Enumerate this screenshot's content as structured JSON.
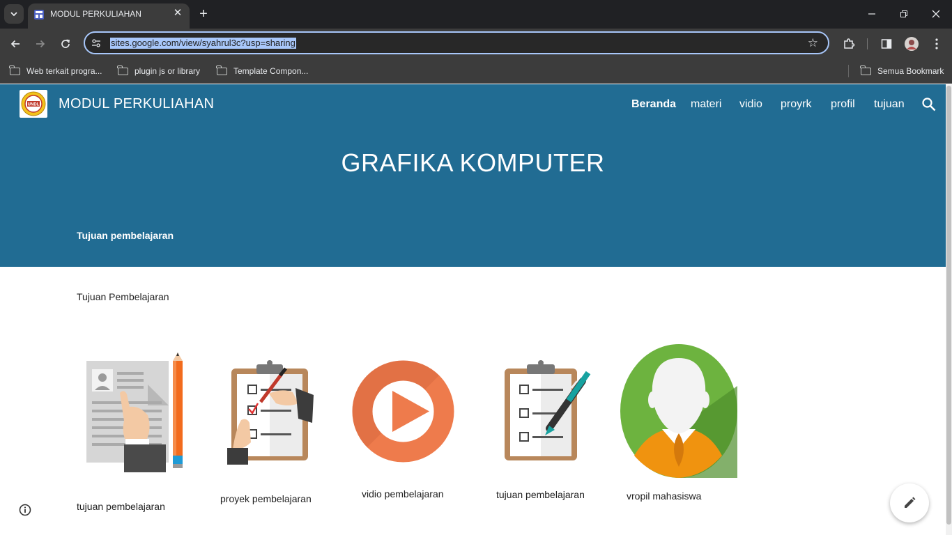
{
  "browser": {
    "tab_title": "MODUL PERKULIAHAN",
    "url": "sites.google.com/view/syahrul3c?usp=sharing",
    "bookmarks": [
      {
        "label": "Web terkait progra..."
      },
      {
        "label": "plugin js or library"
      },
      {
        "label": "Template Compon..."
      }
    ],
    "all_bookmarks_label": "Semua Bookmark"
  },
  "site": {
    "title": "MODUL PERKULIAHAN",
    "logo_text": "UNDL",
    "nav": [
      {
        "label": "Beranda",
        "active": true
      },
      {
        "label": "materi"
      },
      {
        "label": "vidio"
      },
      {
        "label": "proyrk"
      },
      {
        "label": "profil"
      },
      {
        "label": "tujuan"
      }
    ]
  },
  "hero": {
    "title": "GRAFIKA KOMPUTER",
    "subtitle": "Tujuan pembelajaran"
  },
  "content": {
    "intro": "Tujuan Pembelajaran",
    "cards": [
      {
        "caption": "tujuan pembelajaran",
        "icon": "resume-pencil-icon"
      },
      {
        "caption": "proyek pembelajaran",
        "icon": "clipboard-checklist-icon"
      },
      {
        "caption": "vidio pembelajaran",
        "icon": "play-circle-icon"
      },
      {
        "caption": "tujuan pembelajaran",
        "icon": "clipboard-pen-icon"
      },
      {
        "caption": "vropil mahasiswa",
        "icon": "person-avatar-icon"
      }
    ]
  },
  "colors": {
    "hero_bg": "#216c93",
    "play_orange": "#ee7b4c",
    "avatar_green": "#6db33f"
  }
}
